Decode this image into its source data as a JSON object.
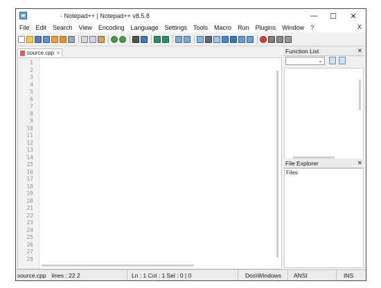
{
  "window": {
    "title": "- Notepad++ | Notepad++ v8.5.8",
    "controls": {
      "minimize": "—",
      "maximize": "☐",
      "close": "✕"
    }
  },
  "menu": {
    "items": [
      "File",
      "Edit",
      "Search",
      "View",
      "Encoding",
      "Language",
      "Settings",
      "Tools",
      "Macro",
      "Run",
      "Plugins",
      "Window",
      "?"
    ],
    "close_label": "X"
  },
  "toolbar": {
    "icons": [
      "new-file-icon",
      "open-file-icon",
      "save-icon",
      "save-all-icon",
      "close-icon",
      "close-all-icon",
      "print-icon",
      "cut-icon",
      "copy-icon",
      "paste-icon",
      "undo-icon",
      "redo-icon",
      "find-icon",
      "replace-icon",
      "zoom-in-icon",
      "zoom-out-icon",
      "sync-vertical-icon",
      "sync-horizontal-icon",
      "word-wrap-icon",
      "show-all-chars-icon",
      "indent-guide-icon",
      "document-map-icon",
      "function-list-icon",
      "folder-workspace-icon",
      "monitoring-icon",
      "record-macro-icon",
      "stop-macro-icon",
      "play-macro-icon",
      "save-macro-icon"
    ]
  },
  "tab": {
    "label": "source.cpp",
    "close": "✕"
  },
  "editor": {
    "lines": [
      "1",
      "2",
      "3",
      "4",
      "5",
      "6",
      "7",
      "8",
      "9",
      "10",
      "11",
      "12",
      "13",
      "14",
      "15",
      "16",
      "17",
      "18",
      "19",
      "20",
      "21",
      "22",
      "23",
      "24",
      "25",
      "26",
      "27",
      "28"
    ]
  },
  "function_list": {
    "title": "Function List",
    "close": "✕",
    "combo_value": ""
  },
  "file_explorer": {
    "title": "File Explorer",
    "close": "✕",
    "root": "Files"
  },
  "status": {
    "file": "source.cpp",
    "lines": "lines : 22 2",
    "position": "Ln : 1   Col : 1   Sel : 0 | 0",
    "eol": "Dos\\Windows",
    "encoding": "ANSI",
    "mode": "INS"
  },
  "colors": {
    "accent_blue": "#6aa7d8",
    "tab_icon_red": "#e35b5b"
  }
}
